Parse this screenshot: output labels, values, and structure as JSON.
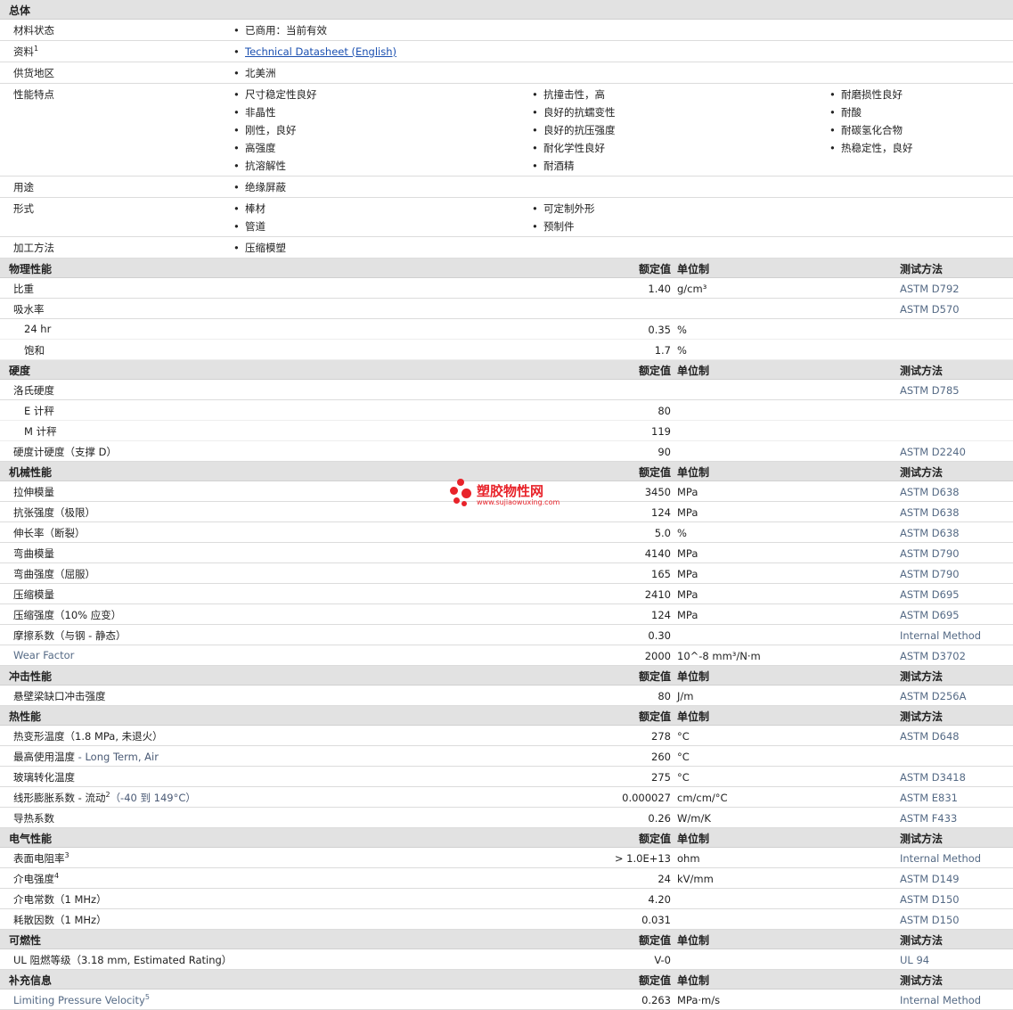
{
  "general": {
    "title": "总体",
    "rows": [
      {
        "label": "材料状态",
        "height": 23,
        "cols": [
          [
            "已商用：当前有效"
          ]
        ]
      },
      {
        "label": "资料",
        "sup": "1",
        "height": 23,
        "link": true,
        "cols": [
          [
            "Technical Datasheet (English)"
          ]
        ]
      },
      {
        "label": "供货地区",
        "height": 23,
        "cols": [
          [
            "北美洲"
          ]
        ]
      },
      {
        "label": "性能特点",
        "height": 103,
        "cols": [
          [
            "尺寸稳定性良好",
            "非晶性",
            "刚性，良好",
            "高强度",
            "抗溶解性"
          ],
          [
            "抗撞击性，高",
            "良好的抗蠕变性",
            "良好的抗压强度",
            "耐化学性良好",
            "耐酒精"
          ],
          [
            "耐磨损性良好",
            "耐酸",
            "耐碳氢化合物",
            "热稳定性，良好"
          ]
        ]
      },
      {
        "label": "用途",
        "height": 23,
        "cols": [
          [
            "绝缘屏蔽"
          ]
        ]
      },
      {
        "label": "形式",
        "height": 43,
        "cols": [
          [
            "棒材",
            "管道"
          ],
          [
            "可定制外形",
            "预制件"
          ]
        ]
      },
      {
        "label": "加工方法",
        "height": 23,
        "cols": [
          [
            "压缩模塑"
          ]
        ]
      }
    ]
  },
  "headers": {
    "value": "额定值",
    "unit": "单位制",
    "method": "测试方法"
  },
  "sections": [
    {
      "title": "物理性能",
      "rows": [
        {
          "name": "比重",
          "value": "1.40",
          "unit": "g/cm³",
          "method": "ASTM D792"
        },
        {
          "name": "吸水率",
          "value": "",
          "unit": "",
          "method": "ASTM D570"
        },
        {
          "name": "24 hr",
          "sub": true,
          "value": "0.35",
          "unit": "%",
          "method": ""
        },
        {
          "name": "饱和",
          "sub": true,
          "value": "1.7",
          "unit": "%",
          "method": ""
        }
      ]
    },
    {
      "title": "硬度",
      "rows": [
        {
          "name": "洛氏硬度",
          "value": "",
          "unit": "",
          "method": "ASTM D785"
        },
        {
          "name": "E 计秤",
          "sub": true,
          "value": "80",
          "unit": "",
          "method": ""
        },
        {
          "name": "M 计秤",
          "sub": true,
          "value": "119",
          "unit": "",
          "method": ""
        },
        {
          "name": "硬度计硬度（支撑 D）",
          "value": "90",
          "unit": "",
          "method": "ASTM D2240"
        }
      ]
    },
    {
      "title": "机械性能",
      "rows": [
        {
          "name": "拉伸模量",
          "value": "3450",
          "unit": "MPa",
          "method": "ASTM D638"
        },
        {
          "name": "抗张强度（极限）",
          "value": "124",
          "unit": "MPa",
          "method": "ASTM D638"
        },
        {
          "name": "伸长率（断裂）",
          "value": "5.0",
          "unit": "%",
          "method": "ASTM D638"
        },
        {
          "name": "弯曲模量",
          "value": "4140",
          "unit": "MPa",
          "method": "ASTM D790"
        },
        {
          "name": "弯曲强度（屈服）",
          "value": "165",
          "unit": "MPa",
          "method": "ASTM D790"
        },
        {
          "name": "压缩模量",
          "value": "2410",
          "unit": "MPa",
          "method": "ASTM D695"
        },
        {
          "name": "压缩强度（10% 应变）",
          "value": "124",
          "unit": "MPa",
          "method": "ASTM D695"
        },
        {
          "name": "摩擦系数（与钢 - 静态）",
          "value": "0.30",
          "unit": "",
          "method": "Internal Method"
        },
        {
          "name": "Wear Factor",
          "en": true,
          "value": "2000",
          "unit": "10^-8 mm³/N·m",
          "method": "ASTM D3702"
        }
      ]
    },
    {
      "title": "冲击性能",
      "rows": [
        {
          "name": "悬壁梁缺口冲击强度",
          "value": "80",
          "unit": "J/m",
          "method": "ASTM D256A"
        }
      ]
    },
    {
      "title": "热性能",
      "rows": [
        {
          "name": "热变形温度（1.8 MPa, 未退火）",
          "value": "278",
          "unit": "°C",
          "method": "ASTM D648"
        },
        {
          "name": "最高使用温度",
          "extra": " - Long Term, Air",
          "value": "260",
          "unit": "°C",
          "method": ""
        },
        {
          "name": "玻璃转化温度",
          "value": "275",
          "unit": "°C",
          "method": "ASTM D3418"
        },
        {
          "name": "线形膨胀系数 - 流动",
          "sup": "2",
          "extra": "（-40 到  149°C）",
          "value": "0.000027",
          "unit": "cm/cm/°C",
          "method": "ASTM E831"
        },
        {
          "name": "导热系数",
          "value": "0.26",
          "unit": "W/m/K",
          "method": "ASTM F433"
        }
      ]
    },
    {
      "title": "电气性能",
      "rows": [
        {
          "name": "表面电阻率",
          "sup": "3",
          "value": "> 1.0E+13",
          "unit": "ohm",
          "method": "Internal Method"
        },
        {
          "name": "介电强度",
          "sup": "4",
          "value": "24",
          "unit": "kV/mm",
          "method": "ASTM D149"
        },
        {
          "name": "介电常数（1 MHz）",
          "value": "4.20",
          "unit": "",
          "method": "ASTM D150"
        },
        {
          "name": "耗散因数（1 MHz）",
          "value": "0.031",
          "unit": "",
          "method": "ASTM D150"
        }
      ]
    },
    {
      "title": "可燃性",
      "rows": [
        {
          "name": "UL 阻燃等级（3.18 mm, Estimated Rating）",
          "value": "V-0",
          "unit": "",
          "method": "UL 94"
        }
      ]
    },
    {
      "title": "补充信息",
      "rows": [
        {
          "name": "Limiting Pressure Velocity",
          "en": true,
          "sup": "5",
          "value": "0.263",
          "unit": "MPa·m/s",
          "method": "Internal Method"
        }
      ]
    }
  ],
  "watermark": {
    "title": "塑胶物性网",
    "url": "www.sujiaowuxing.com"
  }
}
